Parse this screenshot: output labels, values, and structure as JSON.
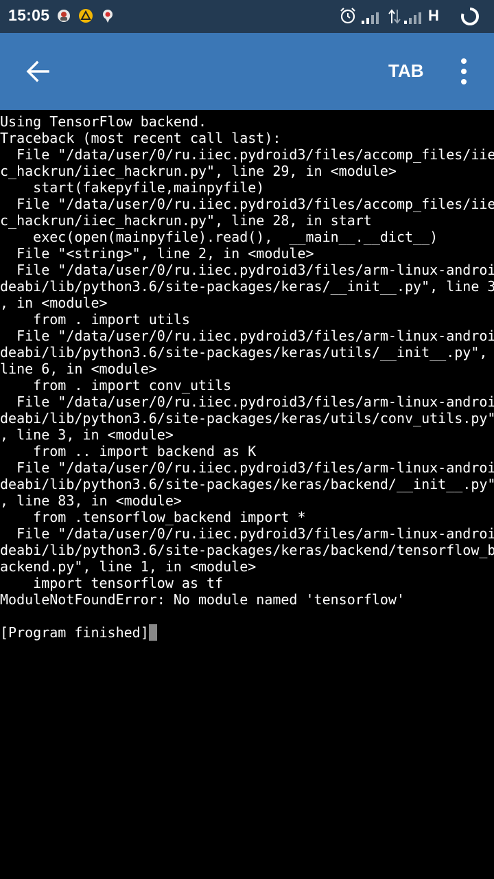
{
  "status_bar": {
    "time": "15:05",
    "network_type": "H",
    "icons": [
      "app-notification-icon",
      "warning-notification-icon",
      "app-notification-icon",
      "alarm-icon",
      "signal-icon",
      "data-arrows-icon",
      "signal-icon",
      "loading-icon"
    ]
  },
  "app_bar": {
    "back_icon": "arrow-left-icon",
    "tab_label": "TAB",
    "more_icon": "more-vert-icon",
    "color": "#3b77b6"
  },
  "terminal": {
    "lines": [
      "Using TensorFlow backend.",
      "Traceback (most recent call last):",
      "  File \"/data/user/0/ru.iiec.pydroid3/files/accomp_files/iie",
      "c_hackrun/iiec_hackrun.py\", line 29, in <module>",
      "    start(fakepyfile,mainpyfile)",
      "  File \"/data/user/0/ru.iiec.pydroid3/files/accomp_files/iie",
      "c_hackrun/iiec_hackrun.py\", line 28, in start",
      "    exec(open(mainpyfile).read(),  __main__.__dict__)",
      "  File \"<string>\", line 2, in <module>",
      "  File \"/data/user/0/ru.iiec.pydroid3/files/arm-linux-androi",
      "deabi/lib/python3.6/site-packages/keras/__init__.py\", line 3",
      ", in <module>",
      "    from . import utils",
      "  File \"/data/user/0/ru.iiec.pydroid3/files/arm-linux-androi",
      "deabi/lib/python3.6/site-packages/keras/utils/__init__.py\",",
      "line 6, in <module>",
      "    from . import conv_utils",
      "  File \"/data/user/0/ru.iiec.pydroid3/files/arm-linux-androi",
      "deabi/lib/python3.6/site-packages/keras/utils/conv_utils.py\"",
      ", line 3, in <module>",
      "    from .. import backend as K",
      "  File \"/data/user/0/ru.iiec.pydroid3/files/arm-linux-androi",
      "deabi/lib/python3.6/site-packages/keras/backend/__init__.py\"",
      ", line 83, in <module>",
      "    from .tensorflow_backend import *",
      "  File \"/data/user/0/ru.iiec.pydroid3/files/arm-linux-androi",
      "deabi/lib/python3.6/site-packages/keras/backend/tensorflow_b",
      "ackend.py\", line 1, in <module>",
      "    import tensorflow as tf",
      "ModuleNotFoundError: No module named 'tensorflow'",
      "",
      "[Program finished]"
    ]
  }
}
